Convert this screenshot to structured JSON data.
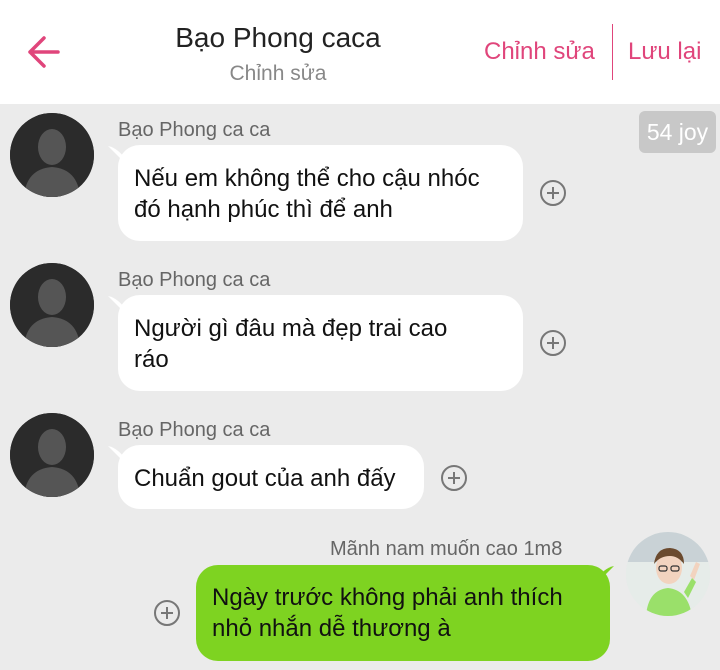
{
  "header": {
    "title": "Bạo Phong caca",
    "subtitle": "Chỉnh sửa",
    "edit_label": "Chỉnh sửa",
    "save_label": "Lưu lại",
    "back_icon": "arrow-left-icon",
    "accent_color": "#e0457b"
  },
  "badge": {
    "text": "54 joy"
  },
  "messages": [
    {
      "sender": "Bạo Phong ca ca",
      "line1": "Nếu em không thể cho cậu nhóc",
      "line2": "đó hạnh phúc thì để anh",
      "side": "left"
    },
    {
      "sender": "Bạo Phong ca ca",
      "line1": "Người gì đâu mà đẹp trai cao",
      "line2": "ráo",
      "side": "left"
    },
    {
      "sender": "Bạo Phong ca ca",
      "line1": "Chuẩn gout của anh đấy",
      "side": "left"
    },
    {
      "sender": "Mãnh nam muốn cao 1m8",
      "line1": "Ngày trước không phải anh thích",
      "line2": "nhỏ nhắn dễ thương à",
      "side": "right",
      "bubble_color": "#7ed321"
    }
  ],
  "icons": {
    "add": "plus-circle-icon",
    "avatar_default": "default-avatar-icon",
    "avatar_photo": "user-photo-avatar"
  }
}
